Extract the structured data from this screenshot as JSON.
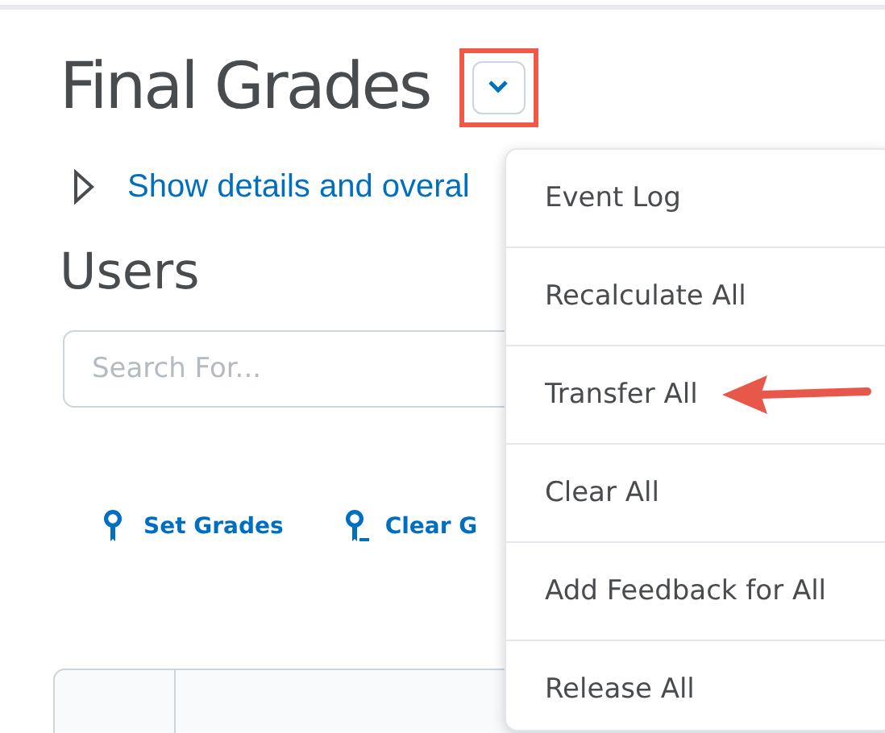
{
  "title": "Final Grades",
  "menu_button": {
    "highlighted": true
  },
  "details_link": "Show details and overal",
  "section_title": "Users",
  "search": {
    "placeholder": "Search For..."
  },
  "actions": [
    {
      "label": "Set Grades",
      "kind": "set"
    },
    {
      "label": "Clear G",
      "kind": "clear"
    }
  ],
  "menu": [
    {
      "label": "Event Log",
      "highlighted": false
    },
    {
      "label": "Recalculate All",
      "highlighted": false
    },
    {
      "label": "Transfer All",
      "highlighted": true
    },
    {
      "label": "Clear All",
      "highlighted": false
    },
    {
      "label": "Add Feedback for All",
      "highlighted": false
    },
    {
      "label": "Release All",
      "highlighted": false
    }
  ]
}
